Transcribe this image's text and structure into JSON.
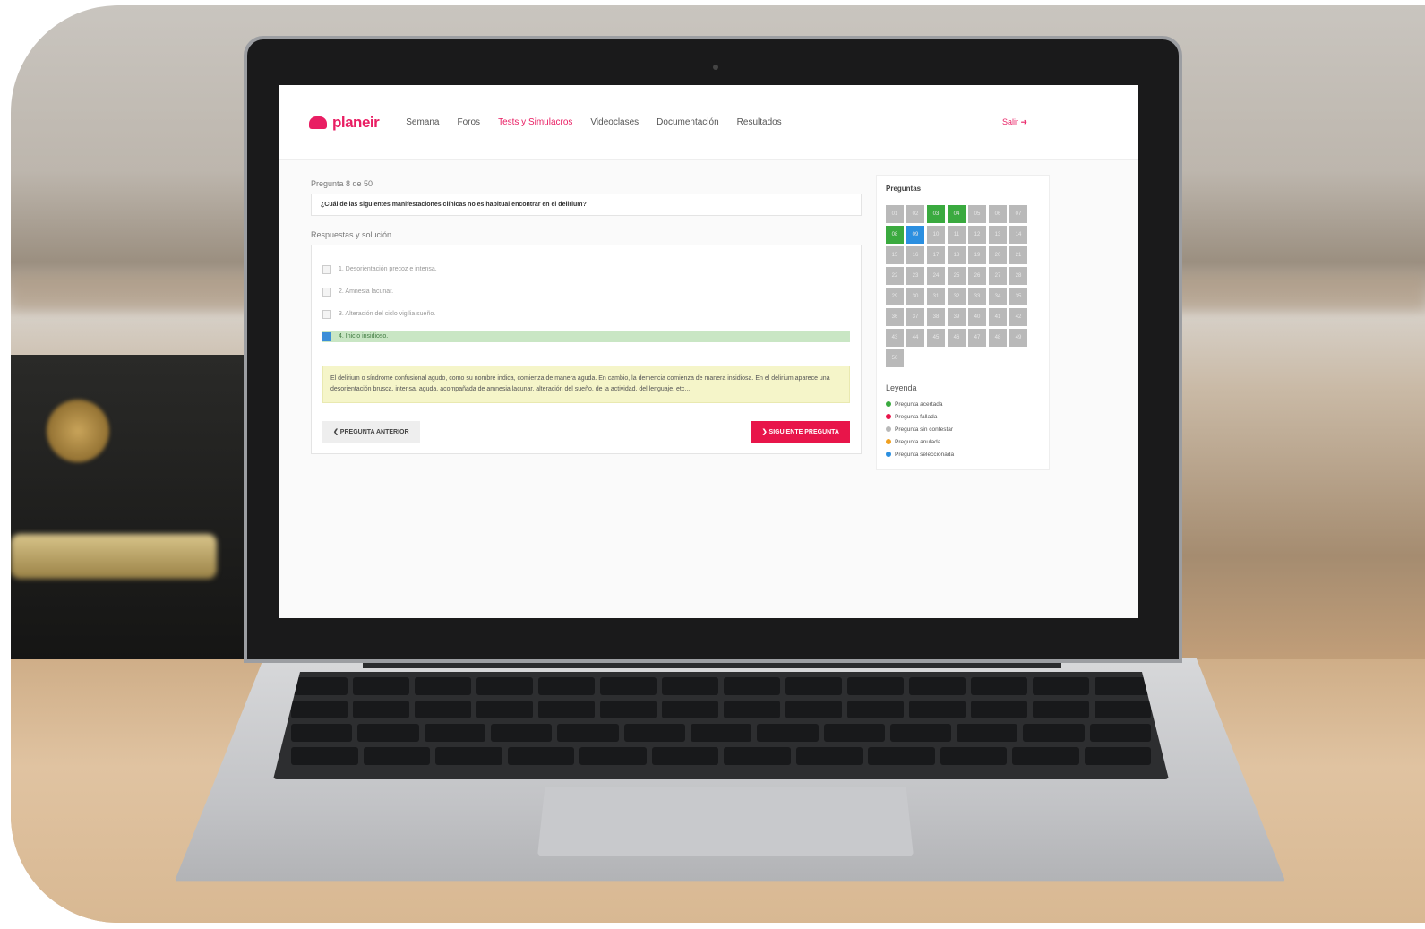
{
  "nav": {
    "logo": "planeir",
    "links": [
      "Semana",
      "Foros",
      "Tests y Simulacros",
      "Videoclases",
      "Documentación",
      "Resultados"
    ],
    "active_index": 2,
    "exit": "Salir ➜"
  },
  "question": {
    "counter": "Pregunta 8 de 50",
    "text": "¿Cuál de las siguientes manifestaciones clínicas no es habitual encontrar en el delirium?"
  },
  "answers_section": {
    "title": "Respuestas y solución",
    "options": [
      {
        "label": "1. Desorientación precoz e intensa."
      },
      {
        "label": "2. Amnesia lacunar."
      },
      {
        "label": "3. Alteración del ciclo vigilia sueño."
      },
      {
        "label": "4. Inicio insidioso."
      }
    ],
    "correct_index": 3,
    "explanation": "El delirium o síndrome confusional agudo, como su nombre indica, comienza de manera aguda. En cambio, la demencia comienza de manera insidiosa. En el delirium aparece una desorientación brusca, intensa, aguda, acompañada de amnesia lacunar, alteración del sueño, de la actividad, del lenguaje, etc..."
  },
  "buttons": {
    "prev": "❮ PREGUNTA ANTERIOR",
    "next": "❯ SIGUIENTE PREGUNTA"
  },
  "sidebar": {
    "title": "Preguntas",
    "cells": [
      "01",
      "02",
      "03",
      "04",
      "05",
      "06",
      "07",
      "08",
      "09",
      "10",
      "11",
      "12",
      "13",
      "14",
      "15",
      "16",
      "17",
      "18",
      "19",
      "20",
      "21",
      "22",
      "23",
      "24",
      "25",
      "26",
      "27",
      "28",
      "29",
      "30",
      "31",
      "32",
      "33",
      "34",
      "35",
      "36",
      "37",
      "38",
      "39",
      "40",
      "41",
      "42",
      "43",
      "44",
      "45",
      "46",
      "47",
      "48",
      "49",
      "50"
    ],
    "correct": [
      2,
      3,
      7
    ],
    "selected": [
      8
    ],
    "legend_title": "Leyenda",
    "legend": [
      {
        "label": "Pregunta acertada",
        "color": "#3aaa3f"
      },
      {
        "label": "Pregunta fallada",
        "color": "#e8154a"
      },
      {
        "label": "Pregunta sin contestar",
        "color": "#b9b9b9"
      },
      {
        "label": "Pregunta anulada",
        "color": "#f0a020"
      },
      {
        "label": "Pregunta seleccionada",
        "color": "#2b8fe0"
      }
    ]
  }
}
